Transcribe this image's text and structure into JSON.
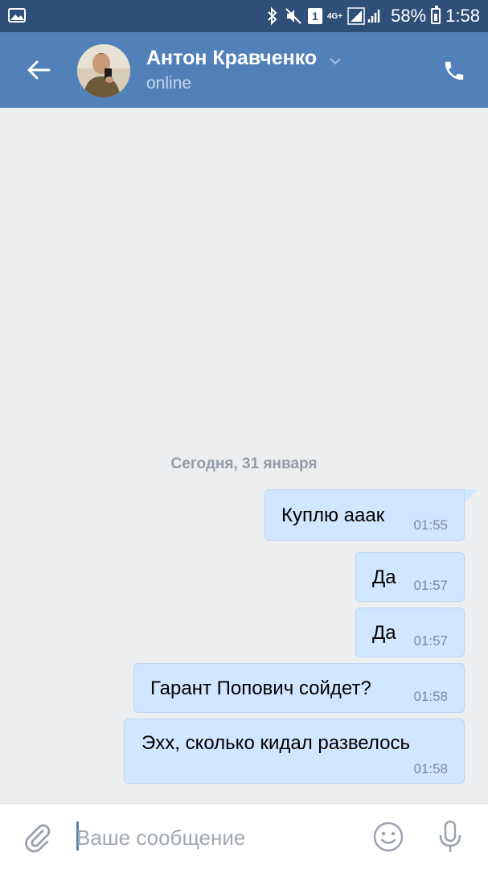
{
  "status_bar": {
    "network_type": "4G+",
    "sim_slot": "1",
    "battery": "58%",
    "time": "1:58"
  },
  "header": {
    "contact_name": "Антон Кравченко",
    "status": "online",
    "accent_color": "#5181b8"
  },
  "chat": {
    "date_separator": "Сегодня, 31 января",
    "messages": [
      {
        "text": "Куплю ааак",
        "time": "01:55"
      },
      {
        "text": "Да",
        "time": "01:57"
      },
      {
        "text": "Да",
        "time": "01:57"
      },
      {
        "text": "Гарант Попович сойдет?",
        "time": "01:58"
      },
      {
        "text": "Эхх, сколько кидал развелось",
        "time": "01:58"
      }
    ]
  },
  "composer": {
    "placeholder": "Ваше сообщение",
    "value": ""
  },
  "icons": {
    "status_left": "image-icon",
    "bluetooth": "bluetooth-icon",
    "mute": "mute-icon",
    "signal": "signal-icon",
    "battery": "battery-icon",
    "back": "back-arrow-icon",
    "chevron": "chevron-down-icon",
    "call": "phone-icon",
    "attach": "paperclip-icon",
    "emoji": "smiley-icon",
    "mic": "microphone-icon"
  }
}
